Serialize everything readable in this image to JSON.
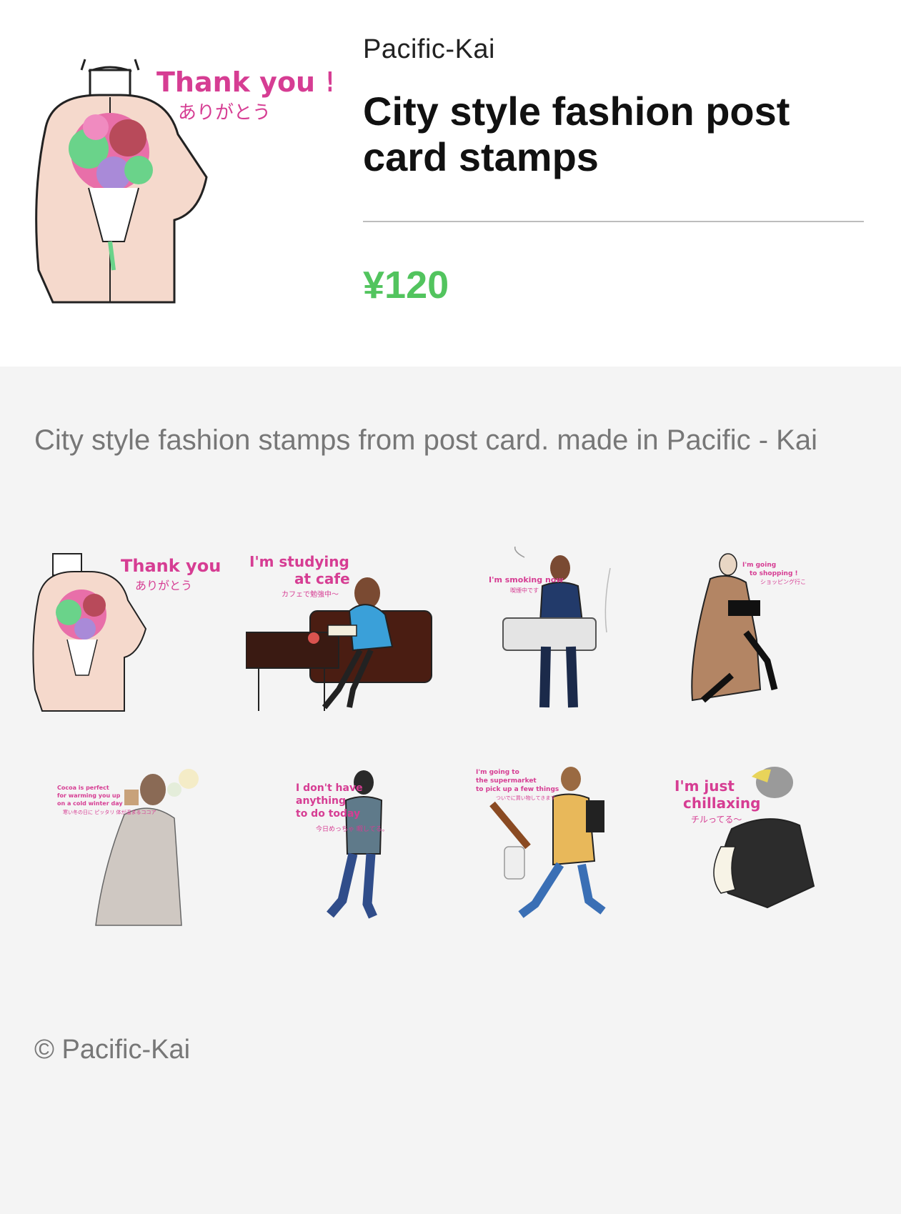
{
  "header": {
    "author": "Pacific-Kai",
    "title": "City style fashion post card stamps",
    "price": "¥120"
  },
  "main_sticker": {
    "caption_en": "Thank you !",
    "caption_jp": "ありがとう"
  },
  "description": "City style fashion stamps from post card. made in Pacific - Kai",
  "stamps": [
    {
      "lines": [
        "Thank you !"
      ],
      "jp": "ありがとう"
    },
    {
      "lines": [
        "I'm studying",
        "at cafe"
      ],
      "jp": "カフェで勉強中〜"
    },
    {
      "lines": [
        "I'm smoking now"
      ],
      "jp": "喫煙中です"
    },
    {
      "lines": [
        "I'm going",
        "to shopping !"
      ],
      "jp": "ショッピング行こ"
    },
    {
      "lines": [
        "Cocoa is perfect",
        "for warming you up",
        "on a cold winter day"
      ],
      "jp": "寒い冬の日に ピッタリ 体が温まるココア"
    },
    {
      "lines": [
        "I don't have",
        "anything",
        "to do today"
      ],
      "jp": "今日めっちゃ 暇してる。"
    },
    {
      "lines": [
        "I'm going to",
        "the supermarket",
        "to pick up a few things"
      ],
      "jp": "ついでに買い物してきます"
    },
    {
      "lines": [
        "I'm just",
        "chillaxing"
      ],
      "jp": "チルってる〜"
    }
  ],
  "copyright": "© Pacific-Kai",
  "colors": {
    "price_green": "#52c45e",
    "caption_pink": "#d63d93",
    "background": "#f4f4f4"
  }
}
